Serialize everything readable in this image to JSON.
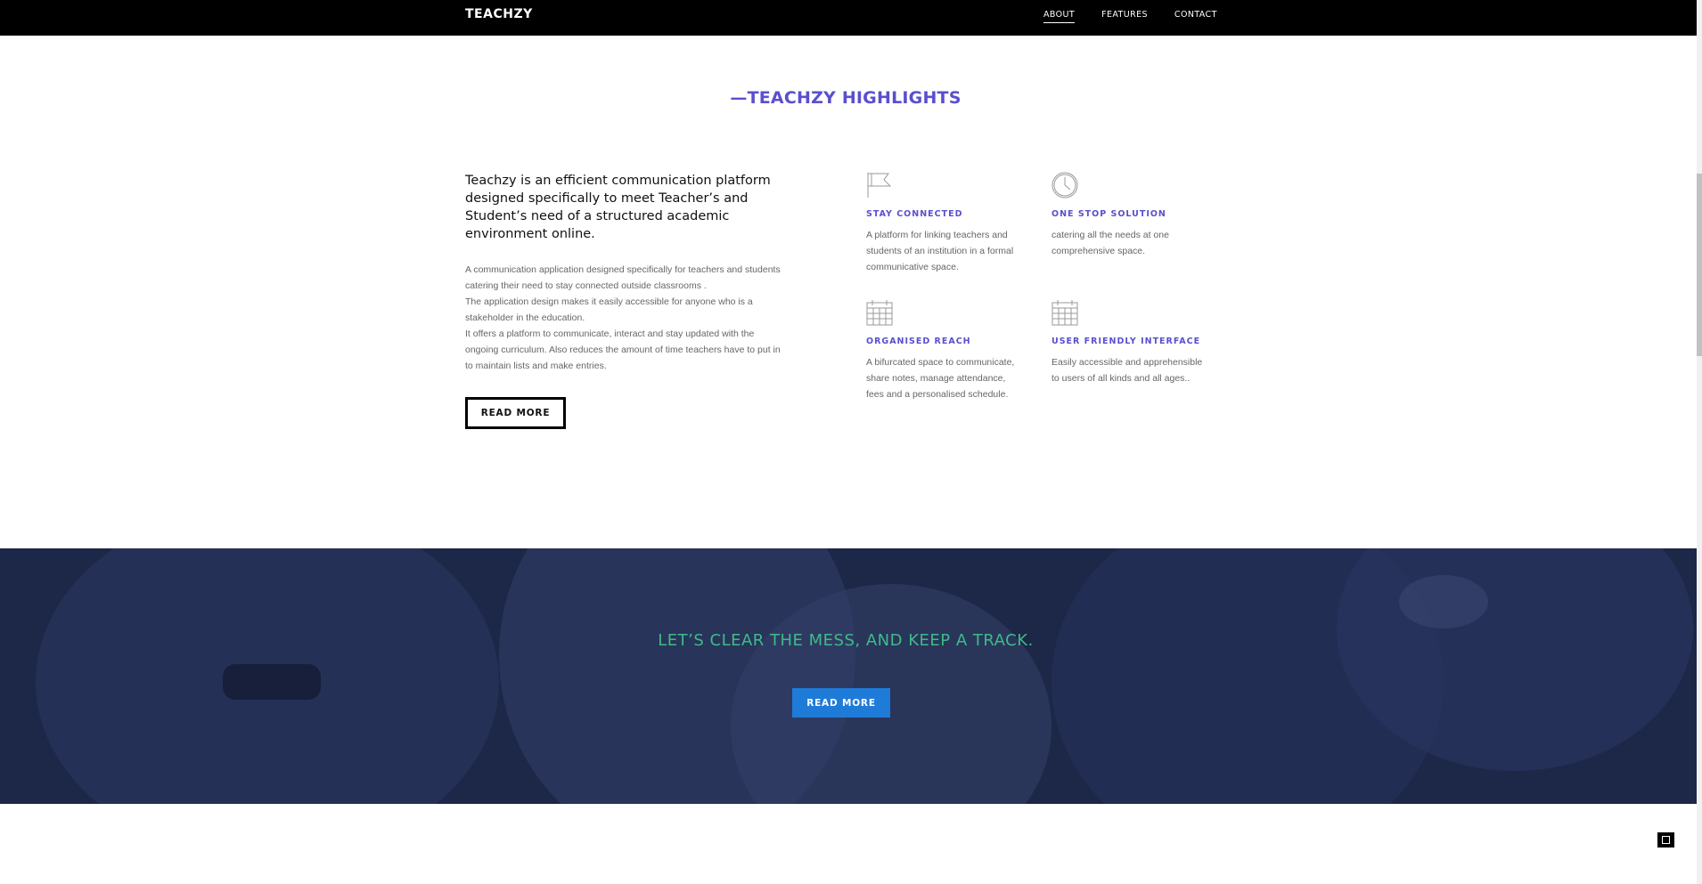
{
  "navbar": {
    "brand": "TEACHZY",
    "links": [
      "ABOUT",
      "FEATURES",
      "CONTACT"
    ],
    "active": "ABOUT"
  },
  "highlights": {
    "title": "—TEACHZY HIGHLIGHTS",
    "lead": "Teachzy is an efficient communication platform designed specifically to meet Teacher’s and Student’s need of a structured academic environment online.",
    "paragraphs": [
      "A communication application designed specifically for teachers and students catering their need to stay connected outside classrooms .",
      "The application design makes it easily accessible for anyone who is a stakeholder in the education.",
      "It offers a platform to communicate, interact and stay updated with the ongoing curriculum. Also reduces the amount of time teachers have to put in to maintain lists and make entries."
    ],
    "button": "READ MORE"
  },
  "features": [
    {
      "icon": "flag-icon",
      "title": "STAY CONNECTED",
      "desc": "A platform for linking teachers and students of an institution in a formal communicative space."
    },
    {
      "icon": "clock-icon",
      "title": "ONE STOP SOLUTION",
      "desc": "catering all the needs at one comprehensive space."
    },
    {
      "icon": "calendar-icon",
      "title": "ORGANISED REACH",
      "desc": "A bifurcated space to communicate, share notes, manage attendance, fees and a personalised schedule."
    },
    {
      "icon": "calendar-icon",
      "title": "USER FRIENDLY INTERFACE",
      "desc": "Easily accessible and apprehensible to users of all kinds and all ages.."
    }
  ],
  "banner": {
    "text": "LET’S CLEAR THE MESS, AND KEEP A TRACK.",
    "button": "READ MORE"
  },
  "colors": {
    "accent": "#5a4fcf",
    "banner_text": "#3dbb8a",
    "button_blue": "#1f7bd8",
    "navbar_bg": "#000000",
    "banner_overlay": "#1f2a4b"
  }
}
